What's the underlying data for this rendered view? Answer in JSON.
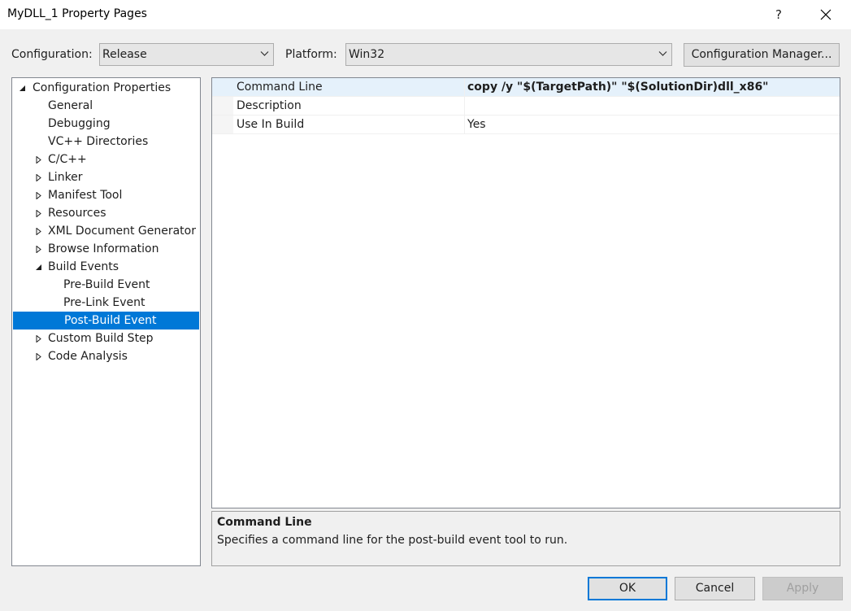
{
  "window": {
    "title": "MyDLL_1 Property Pages",
    "help_label": "?"
  },
  "toolbar": {
    "configuration_label": "Configuration:",
    "configuration_value": "Release",
    "platform_label": "Platform:",
    "platform_value": "Win32",
    "config_manager_label": "Configuration Manager..."
  },
  "tree": {
    "items": [
      {
        "label": "Configuration Properties",
        "expander": "expanded",
        "level": 0
      },
      {
        "label": "General",
        "expander": "none",
        "level": 1
      },
      {
        "label": "Debugging",
        "expander": "none",
        "level": 1
      },
      {
        "label": "VC++ Directories",
        "expander": "none",
        "level": 1
      },
      {
        "label": "C/C++",
        "expander": "collapsed",
        "level": 1
      },
      {
        "label": "Linker",
        "expander": "collapsed",
        "level": 1
      },
      {
        "label": "Manifest Tool",
        "expander": "collapsed",
        "level": 1
      },
      {
        "label": "Resources",
        "expander": "collapsed",
        "level": 1
      },
      {
        "label": "XML Document Generator",
        "expander": "collapsed",
        "level": 1
      },
      {
        "label": "Browse Information",
        "expander": "collapsed",
        "level": 1
      },
      {
        "label": "Build Events",
        "expander": "expanded",
        "level": 1
      },
      {
        "label": "Pre-Build Event",
        "expander": "none",
        "level": 2
      },
      {
        "label": "Pre-Link Event",
        "expander": "none",
        "level": 2
      },
      {
        "label": "Post-Build Event",
        "expander": "none",
        "level": 2,
        "selected": true
      },
      {
        "label": "Custom Build Step",
        "expander": "collapsed",
        "level": 1
      },
      {
        "label": "Code Analysis",
        "expander": "collapsed",
        "level": 1
      }
    ]
  },
  "properties": {
    "rows": [
      {
        "name": "Command Line",
        "value": "copy /y \"$(TargetPath)\" \"$(SolutionDir)dll_x86\"",
        "bold": true,
        "selected": true
      },
      {
        "name": "Description",
        "value": "",
        "bold": false
      },
      {
        "name": "Use In Build",
        "value": "Yes",
        "bold": false
      }
    ]
  },
  "description": {
    "title": "Command Line",
    "text": "Specifies a command line for the post-build event tool to run."
  },
  "buttons": {
    "ok": "OK",
    "cancel": "Cancel",
    "apply": "Apply"
  },
  "colors": {
    "selection": "#0078d7",
    "grid_selection": "#e5f1fb"
  }
}
